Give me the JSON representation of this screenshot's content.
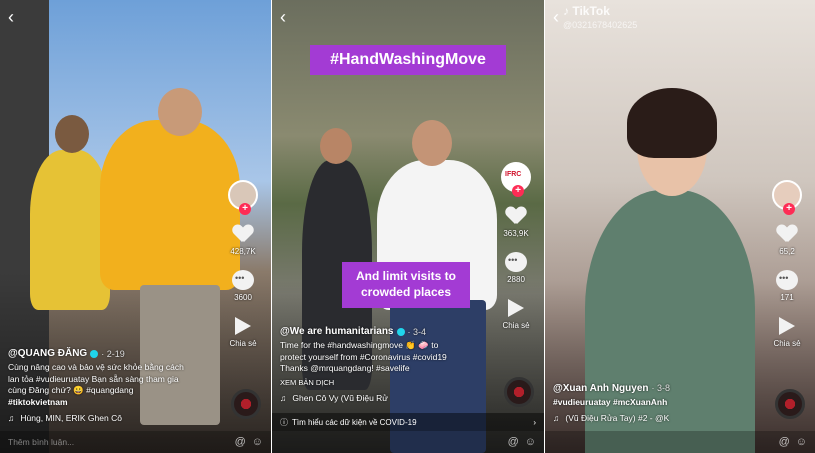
{
  "panels": [
    {
      "handle": "@QUANG ĐĂNG",
      "timestamp": "· 2-19",
      "description_lines": [
        "Cùng nâng cao và bảo vệ sức khỏe bằng cách",
        "lan tỏa #vudieuruatay  Bạn sẵn sàng tham gia",
        "cùng Đăng chứ? 😀 #quangdang",
        "#tiktokvietnam"
      ],
      "music": "Hùng, MIN, ERIK    Ghen Cô",
      "likes": "428,7K",
      "comments": "3600",
      "share_label": "Chia sẻ",
      "comment_placeholder": "Thêm bình luận..."
    },
    {
      "top_label": "#HandWashingMove",
      "mid_label_line1": "And limit visits to",
      "mid_label_line2": "crowded places",
      "handle": "@We are humanitarians",
      "timestamp": "· 3-4",
      "description_lines": [
        "Time for the #handwashingmove 👏 🧼 to",
        "protect yourself from #Coronavirus #covid19",
        "Thanks @mrquangdang! #savelife",
        "XEM BẢN DỊCH"
      ],
      "music": "Ghen Cô Vy (Vũ Điệu Rử",
      "likes": "363,9K",
      "comments": "2880",
      "share_label": "Chia sẻ",
      "avatar_badge": "IFRC",
      "covid_text": "Tìm hiểu các dữ kiện về COVID-19"
    },
    {
      "tiktok_mark": "TikTok",
      "tiktok_id": "@0321678402625",
      "handle": "@Xuan Anh Nguyen",
      "timestamp": "· 3-8",
      "description_lines": [
        "#vudieuruatay  #mcXuanAnh"
      ],
      "music": "(Vũ Điệu Rửa Tay) #2 - @K",
      "likes": "65,2",
      "comments": "171",
      "share_label": "Chia sẻ"
    }
  ],
  "colors": {
    "label_purple": "#a33bd4",
    "tiktok_red": "#fe2c55",
    "verified_cyan": "#20d5ec"
  }
}
